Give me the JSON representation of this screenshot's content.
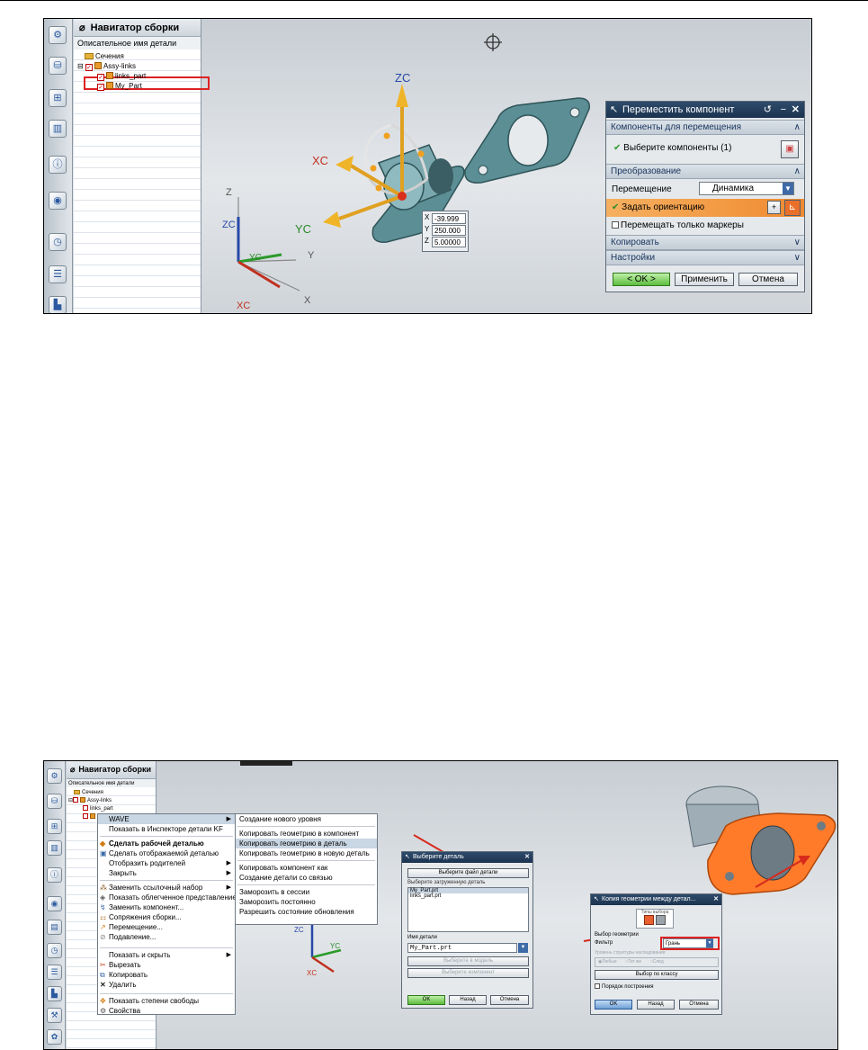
{
  "shot1": {
    "navigator_title": "Навигатор сборки",
    "column_header": "Описательное имя детали",
    "tree": {
      "sections": "Сечения",
      "assembly": "Assy-links",
      "part1": "links_part",
      "part2": "My_Part"
    },
    "axes": {
      "zc": "ZC",
      "xc": "XC",
      "yc": "YC"
    },
    "wcs": {
      "z": "Z",
      "zc": "ZC",
      "y": "Y",
      "yc": "YC",
      "x": "X",
      "xc": "XC"
    },
    "coords": {
      "x_label": "X",
      "x_value": "-39.999",
      "y_label": "Y",
      "y_value": "250.000",
      "z_label": "Z",
      "z_value": "5.00000"
    },
    "dialog": {
      "title": "Переместить компонент",
      "section_components": "Компоненты для перемещения",
      "select_components": "Выберите компоненты (1)",
      "section_transform": "Преобразование",
      "move_label": "Перемещение",
      "move_value": "Динамика",
      "set_orientation": "Задать ориентацию",
      "move_markers_only": "Перемещать только маркеры",
      "section_copy": "Копировать",
      "section_settings": "Настройки",
      "ok": "< OK >",
      "apply": "Применить",
      "cancel": "Отмена"
    }
  },
  "shot2": {
    "navigator_title": "Навигатор сборки",
    "column_header": "Описательное имя детали",
    "tree": {
      "sections": "Сечения",
      "assembly": "Assy-links",
      "part1": "links_part"
    },
    "context_menu": {
      "wave": "WAVE",
      "show_inspector": "Показать в Инспекторе детали KF",
      "make_work": "Сделать рабочей деталью",
      "make_displayed": "Сделать отображаемой деталью",
      "show_parents": "Отобразить родителей",
      "close": "Закрыть",
      "replace_refset": "Заменить ссылочный набор",
      "show_lightweight": "Показать облегченное представление",
      "replace_component": "Заменить компонент...",
      "assembly_constraints": "Сопряжения сборки...",
      "move": "Перемещение...",
      "suppress": "Подавление...",
      "show_hide": "Показать и скрыть",
      "cut": "Вырезать",
      "copy": "Копировать",
      "delete": "Удалить",
      "show_dof": "Показать степени свободы",
      "properties": "Свойства"
    },
    "wave_submenu": {
      "create_level": "Создание нового уровня",
      "copy_geom_component": "Копировать геометрию в компонент",
      "copy_geom_part": "Копировать геометрию в деталь",
      "copy_geom_new_part": "Копировать геометрию в новую деталь",
      "copy_component_as": "Копировать компонент как",
      "create_linked_part": "Создание детали со связью",
      "freeze_session": "Заморозить в сессии",
      "freeze_permanent": "Заморозить постоянно",
      "allow_update": "Разрешить состояние обновления"
    },
    "wcs": {
      "zc": "ZC",
      "yc": "YC",
      "xc": "XC"
    },
    "select_part_dialog": {
      "title": "Выберите деталь",
      "select_file": "Выберите файл детали",
      "loaded_label": "Выберите загруженную деталь",
      "items": [
        "My_Part.prt",
        "links_part.prt"
      ],
      "part_name_label": "Имя детали",
      "part_name_value": "My_Part.prt",
      "pick_owner": "Выберите в модель",
      "pick_component": "Выберите компонент",
      "ok": "OK",
      "back": "Назад",
      "cancel": "Отмена"
    },
    "geom_copy_dialog": {
      "title": "Копия геометрии между детал...",
      "types_label": "Типы выбора",
      "geometry_selection": "Выбор геометрии",
      "filter_label": "Фильтр",
      "filter_value": "Грань",
      "levels_label": "Уровень структуры наследования",
      "opt1": "Любые",
      "opt2": "Тот же",
      "opt3": "След",
      "select_by_class": "Выбор по классу",
      "build_order": "Порядок построения",
      "ok": "OK",
      "back": "Назад",
      "cancel": "Отмена"
    }
  }
}
